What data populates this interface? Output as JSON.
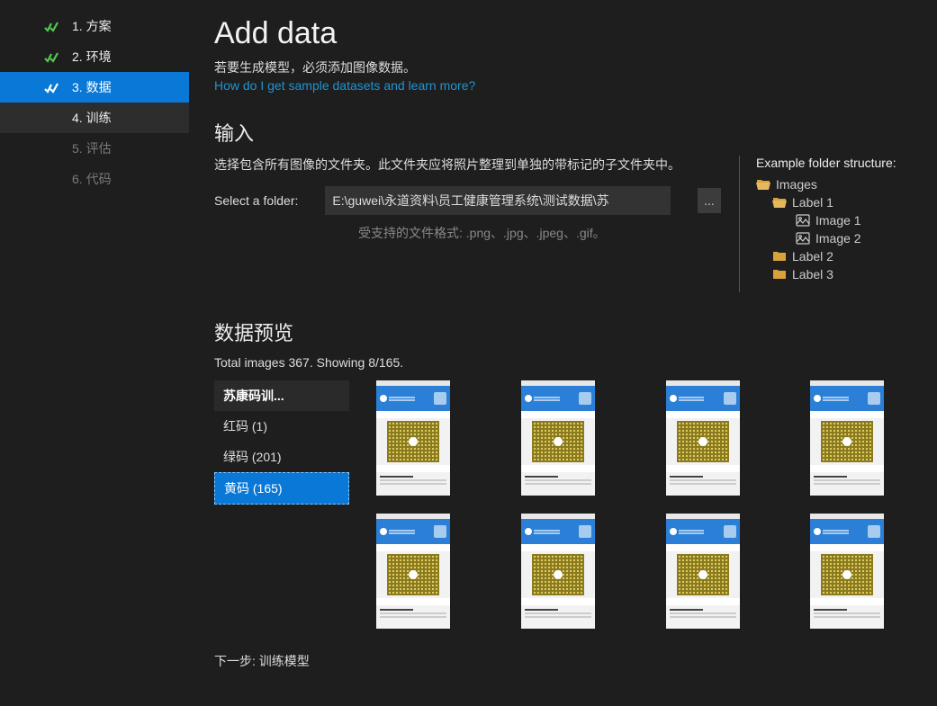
{
  "sidebar": {
    "items": [
      {
        "label": "1. 方案",
        "state": "completed"
      },
      {
        "label": "2. 环境",
        "state": "completed"
      },
      {
        "label": "3. 数据",
        "state": "active"
      },
      {
        "label": "4. 训练",
        "state": "next"
      },
      {
        "label": "5. 评估",
        "state": "disabled"
      },
      {
        "label": "6. 代码",
        "state": "disabled"
      }
    ]
  },
  "page": {
    "title": "Add data",
    "subtitle": "若要生成模型，必须添加图像数据。",
    "help_link": "How do I get sample datasets and learn more?"
  },
  "input": {
    "heading": "输入",
    "description": "选择包含所有图像的文件夹。此文件夹应将照片整理到单独的带标记的子文件夹中。",
    "select_label": "Select a folder:",
    "folder_path": "E:\\guwei\\永道资料\\员工健康管理系统\\测试数据\\苏",
    "browse_btn": "...",
    "formats_label": "受支持的文件格式: .png、.jpg、.jpeg、.gif。"
  },
  "example": {
    "title": "Example folder structure:",
    "tree": {
      "root": "Images",
      "labels": [
        "Label 1",
        "Label 2",
        "Label 3"
      ],
      "images": [
        "Image 1",
        "Image 2"
      ]
    }
  },
  "preview": {
    "heading": "数据预览",
    "summary": "Total images 367. Showing 8/165.",
    "header": "苏康码训...",
    "categories": [
      {
        "label": "红码 (1)",
        "count": 1,
        "selected": false
      },
      {
        "label": "绿码 (201)",
        "count": 201,
        "selected": false
      },
      {
        "label": "黄码 (165)",
        "count": 165,
        "selected": true
      }
    ],
    "thumb_count": 8
  },
  "next_step": "下一步: 训练模型"
}
